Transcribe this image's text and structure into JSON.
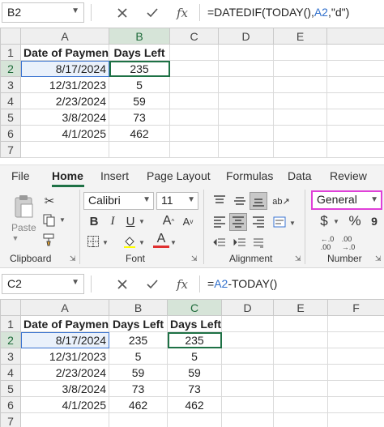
{
  "top": {
    "name_box": "B2",
    "formula_prefix": "=DATEDIF(TODAY(),",
    "formula_ref": "A2",
    "formula_suffix": ",\"d\")",
    "columns": [
      "A",
      "B",
      "C",
      "D",
      "E"
    ],
    "rows": [
      {
        "n": "1",
        "a": "Date of Payment",
        "b": "Days Left"
      },
      {
        "n": "2",
        "a": "8/17/2024",
        "b": "235"
      },
      {
        "n": "3",
        "a": "12/31/2023",
        "b": "5"
      },
      {
        "n": "4",
        "a": "2/23/2024",
        "b": "59"
      },
      {
        "n": "5",
        "a": "3/8/2024",
        "b": "73"
      },
      {
        "n": "6",
        "a": "4/1/2025",
        "b": "462"
      },
      {
        "n": "7",
        "a": "",
        "b": ""
      }
    ]
  },
  "ribbon": {
    "tabs": [
      "File",
      "Home",
      "Insert",
      "Page Layout",
      "Formulas",
      "Data",
      "Review"
    ],
    "active_tab": "Home",
    "font_name": "Calibri",
    "font_size": "11",
    "number_format": "General",
    "paste_label": "Paste",
    "groups": {
      "clipboard": "Clipboard",
      "font": "Font",
      "alignment": "Alignment",
      "number": "Number"
    },
    "buttons": {
      "bold": "B",
      "italic": "I",
      "underline": "U",
      "grow": "A",
      "shrink": "A",
      "font_color": "A",
      "currency": "$",
      "percent": "%"
    },
    "accent": "#1e7145",
    "highlight_border": "#e040d8"
  },
  "bottom": {
    "name_box": "C2",
    "formula_prefix": "=",
    "formula_ref": "A2",
    "formula_suffix": "-TODAY()",
    "columns": [
      "A",
      "B",
      "C",
      "D",
      "E",
      "F"
    ],
    "rows": [
      {
        "n": "1",
        "a": "Date of Payment",
        "b": "Days Left",
        "c": "Days Left"
      },
      {
        "n": "2",
        "a": "8/17/2024",
        "b": "235",
        "c": "235"
      },
      {
        "n": "3",
        "a": "12/31/2023",
        "b": "5",
        "c": "5"
      },
      {
        "n": "4",
        "a": "2/23/2024",
        "b": "59",
        "c": "59"
      },
      {
        "n": "5",
        "a": "3/8/2024",
        "b": "73",
        "c": "73"
      },
      {
        "n": "6",
        "a": "4/1/2025",
        "b": "462",
        "c": "462"
      },
      {
        "n": "7",
        "a": "",
        "b": "",
        "c": ""
      }
    ]
  }
}
